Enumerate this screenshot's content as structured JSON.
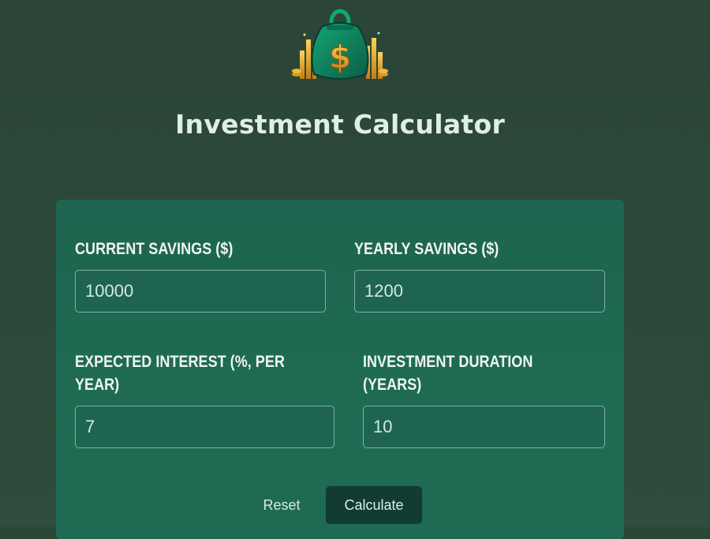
{
  "app": {
    "logo_icon": "money-bag-icon",
    "title": "Investment Calculator"
  },
  "form": {
    "current_savings": {
      "label": "CURRENT SAVINGS ($)",
      "value": "10000"
    },
    "yearly_savings": {
      "label": "YEARLY SAVINGS ($)",
      "value": "1200"
    },
    "expected_interest": {
      "label": "EXPECTED INTEREST (%, PER YEAR)",
      "value": "7"
    },
    "investment_duration": {
      "label": "INVESTMENT DURATION (YEARS)",
      "value": "10"
    }
  },
  "actions": {
    "reset_label": "Reset",
    "calculate_label": "Calculate"
  },
  "colors": {
    "background": "#2c4a3a",
    "card": "#1f6a52",
    "calculate_button": "#123c31",
    "gold": "#e6a21a"
  }
}
